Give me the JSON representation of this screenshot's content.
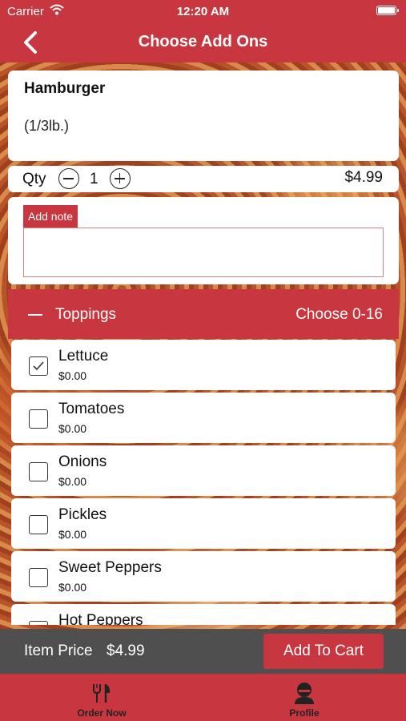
{
  "status": {
    "carrier": "Carrier",
    "time": "12:20 AM",
    "icons": [
      "wifi-icon",
      "battery-icon"
    ]
  },
  "nav": {
    "title": "Choose Add Ons",
    "back_icon": "chevron-left-icon"
  },
  "item": {
    "name": "Hamburger",
    "description": "(1/3lb.)"
  },
  "quantity": {
    "label": "Qty",
    "value": "1",
    "price": "$4.99"
  },
  "note": {
    "label": "Add note",
    "value": ""
  },
  "section": {
    "name": "Toppings",
    "choose": "Choose 0-16"
  },
  "options": [
    {
      "name": "Lettuce",
      "price": "$0.00",
      "checked": true
    },
    {
      "name": "Tomatoes",
      "price": "$0.00",
      "checked": false
    },
    {
      "name": "Onions",
      "price": "$0.00",
      "checked": false
    },
    {
      "name": "Pickles",
      "price": "$0.00",
      "checked": false
    },
    {
      "name": "Sweet Peppers",
      "price": "$0.00",
      "checked": false
    },
    {
      "name": "Hot Peppers",
      "price": "",
      "checked": false
    }
  ],
  "footer": {
    "price_label": "Item Price",
    "price_value": "$4.99",
    "add_button": "Add To Cart"
  },
  "tabs": [
    {
      "label": "Order Now",
      "icon": "fork-knife-icon"
    },
    {
      "label": "Profile",
      "icon": "profile-icon"
    }
  ],
  "colors": {
    "accent": "#c8363f",
    "footer": "#4f4f4f"
  }
}
